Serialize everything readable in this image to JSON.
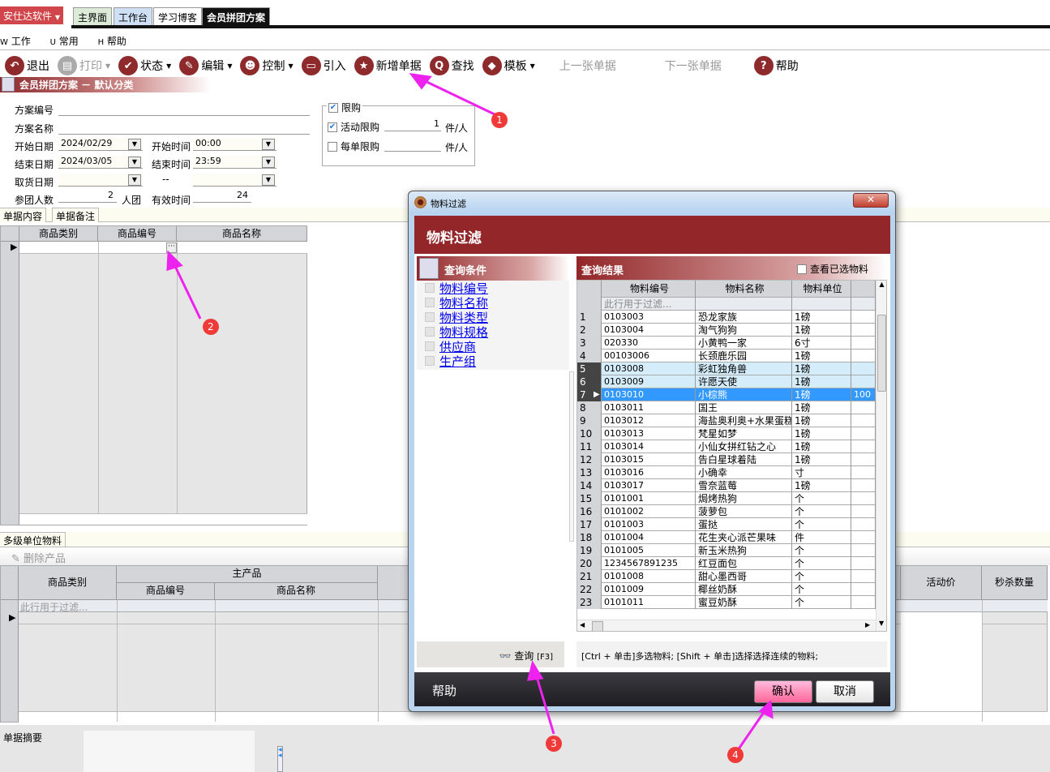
{
  "app": {
    "brand": "安仕达软件",
    "tabs": [
      "主界面",
      "工作台",
      "学习博客",
      "会员拼团方案"
    ],
    "active_tab": "会员拼团方案"
  },
  "menu": [
    {
      "key": "W",
      "label": "工作"
    },
    {
      "key": "U",
      "label": "常用"
    },
    {
      "key": "H",
      "label": "帮助"
    }
  ],
  "toolbar": [
    {
      "label": "退出",
      "icon": "back-icon",
      "enabled": true,
      "dropdown": false
    },
    {
      "label": "打印",
      "icon": "printer-icon",
      "enabled": false,
      "dropdown": true
    },
    {
      "label": "状态",
      "icon": "check-icon",
      "enabled": true,
      "dropdown": true
    },
    {
      "label": "编辑",
      "icon": "pencil-icon",
      "enabled": true,
      "dropdown": true
    },
    {
      "label": "控制",
      "icon": "user-icon",
      "enabled": true,
      "dropdown": true
    },
    {
      "label": "引入",
      "icon": "folder-icon",
      "enabled": true,
      "dropdown": false
    },
    {
      "label": "新增单据",
      "icon": "star-icon",
      "enabled": true,
      "dropdown": false
    },
    {
      "label": "查找",
      "icon": "search-icon",
      "enabled": true,
      "dropdown": false
    },
    {
      "label": "模板",
      "icon": "eraser-icon",
      "enabled": true,
      "dropdown": true
    },
    {
      "label": "上一张单据",
      "icon": "",
      "enabled": false,
      "dropdown": false
    },
    {
      "label": "下一张单据",
      "icon": "",
      "enabled": false,
      "dropdown": false
    },
    {
      "label": "帮助",
      "icon": "help-icon",
      "enabled": true,
      "dropdown": false
    }
  ],
  "page_title": "会员拼团方案 － 默认分类",
  "form": {
    "plan_no_label": "方案编号",
    "plan_no": "",
    "plan_name_label": "方案名称",
    "plan_name": "",
    "start_date_label": "开始日期",
    "start_date": "2024/02/29",
    "start_time_label": "开始时间",
    "start_time": "00:00",
    "end_date_label": "结束日期",
    "end_date": "2024/03/05",
    "end_time_label": "结束时间",
    "end_time": "23:59",
    "pickup_label": "取货日期",
    "pickup_from": "",
    "pickup_sep": "--",
    "pickup_to": "",
    "members_label": "参团人数",
    "members": "2",
    "members_unit": "人团",
    "valid_label": "有效时间",
    "valid": "24"
  },
  "limit": {
    "title": "限购",
    "checked": true,
    "activity_label": "活动限购",
    "activity_checked": true,
    "activity_value": "1",
    "activity_unit": "件/人",
    "order_label": "每单限购",
    "order_checked": false,
    "order_value": "",
    "order_unit": "件/人"
  },
  "doc_tabs": [
    "单据内容",
    "单据备注"
  ],
  "top_grid": {
    "columns": [
      "商品类别",
      "商品编号",
      "商品名称"
    ],
    "ellipsis": "···"
  },
  "lower_tab": "多级单位物料",
  "delete_button": "删除产品",
  "lower_grid": {
    "col_category": "商品类别",
    "group": "主产品",
    "col_code": "商品编号",
    "col_name": "商品名称",
    "col_price": "活动价",
    "col_qty": "秒杀数量",
    "filter_hint": "此行用于过滤..."
  },
  "summary_label": "单据摘要",
  "dialog": {
    "title": "物料过滤",
    "header": "物料过滤",
    "conditions_title": "查询条件",
    "conditions": [
      "物料编号",
      "物料名称",
      "物料类型",
      "物料规格",
      "供应商",
      "生产组"
    ],
    "query_button": "查询",
    "query_shortcut": "[F3]",
    "results_title": "查询结果",
    "view_selected": "查看已选物料",
    "columns": [
      "物料编号",
      "物料名称",
      "物料单位"
    ],
    "filter_hint": "此行用于过滤...",
    "rows": [
      {
        "n": "1",
        "code": "0103003",
        "name": "恐龙家族",
        "unit": "1磅",
        "extra": ""
      },
      {
        "n": "2",
        "code": "0103004",
        "name": "淘气狗狗",
        "unit": "1磅",
        "extra": ""
      },
      {
        "n": "3",
        "code": "020330",
        "name": "小黄鸭一家",
        "unit": "6寸",
        "extra": ""
      },
      {
        "n": "4",
        "code": "00103006",
        "name": "长颈鹿乐园",
        "unit": "1磅",
        "extra": ""
      },
      {
        "n": "5",
        "code": "0103008",
        "name": "彩虹独角兽",
        "unit": "1磅",
        "extra": "",
        "state": "selected"
      },
      {
        "n": "6",
        "code": "0103009",
        "name": "许愿天使",
        "unit": "1磅",
        "extra": "",
        "state": "selected"
      },
      {
        "n": "7",
        "code": "0103010",
        "name": "小棕熊",
        "unit": "1磅",
        "extra": "100",
        "state": "current"
      },
      {
        "n": "8",
        "code": "0103011",
        "name": "国王",
        "unit": "1磅",
        "extra": ""
      },
      {
        "n": "9",
        "code": "0103012",
        "name": "海盐奥利奥+水果蛋糕",
        "unit": "1磅",
        "extra": ""
      },
      {
        "n": "10",
        "code": "0103013",
        "name": "梵星如梦",
        "unit": "1磅",
        "extra": ""
      },
      {
        "n": "11",
        "code": "0103014",
        "name": "小仙女拼红钻之心",
        "unit": "1磅",
        "extra": ""
      },
      {
        "n": "12",
        "code": "0103015",
        "name": "告白星球着陆",
        "unit": "1磅",
        "extra": ""
      },
      {
        "n": "13",
        "code": "0103016",
        "name": "小确幸",
        "unit": "寸",
        "extra": ""
      },
      {
        "n": "14",
        "code": "0103017",
        "name": "雪奈蓝莓",
        "unit": "1磅",
        "extra": ""
      },
      {
        "n": "15",
        "code": "0101001",
        "name": "焗烤热狗",
        "unit": "个",
        "extra": ""
      },
      {
        "n": "16",
        "code": "0101002",
        "name": "菠萝包",
        "unit": "个",
        "extra": ""
      },
      {
        "n": "17",
        "code": "0101003",
        "name": "蛋挞",
        "unit": "个",
        "extra": ""
      },
      {
        "n": "18",
        "code": "0101004",
        "name": "花生夹心派芒果味",
        "unit": "件",
        "extra": ""
      },
      {
        "n": "19",
        "code": "0101005",
        "name": "新玉米热狗",
        "unit": "个",
        "extra": ""
      },
      {
        "n": "20",
        "code": "1234567891235",
        "name": "红豆面包",
        "unit": "个",
        "extra": ""
      },
      {
        "n": "21",
        "code": "0101008",
        "name": "甜心墨西哥",
        "unit": "个",
        "extra": ""
      },
      {
        "n": "22",
        "code": "0101009",
        "name": "椰丝奶酥",
        "unit": "个",
        "extra": ""
      },
      {
        "n": "23",
        "code": "0101011",
        "name": "蜜豆奶酥",
        "unit": "个",
        "extra": ""
      }
    ],
    "hint": "[Ctrl + 单击]多选物料; [Shift + 单击]选择选择连续的物料;",
    "help": "帮助",
    "confirm": "确认",
    "cancel": "取消"
  },
  "annotations": [
    "1",
    "2",
    "3",
    "4"
  ],
  "colors": {
    "brand": "#d0464a",
    "accent": "#922628",
    "selection": "#3399ff",
    "annotation": "#ee22ee"
  }
}
